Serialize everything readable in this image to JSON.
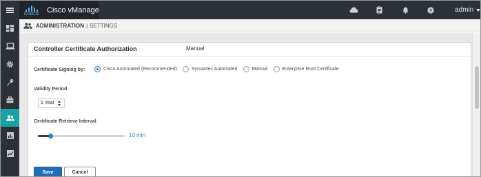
{
  "app": {
    "logo_text": "CISCO",
    "title": "Cisco vManage"
  },
  "header": {
    "icons": [
      "cloud-icon",
      "clipboard-icon",
      "bell-icon",
      "help-icon"
    ],
    "user": "admin"
  },
  "sidebar": {
    "items": [
      {
        "icon": "dashboard-icon",
        "active": false
      },
      {
        "icon": "monitor-icon",
        "active": false
      },
      {
        "icon": "configuration-gear-icon",
        "active": false
      },
      {
        "icon": "tools-wrench-icon",
        "active": false
      },
      {
        "icon": "maintenance-toolbox-icon",
        "active": false
      },
      {
        "icon": "administration-users-icon",
        "active": true
      },
      {
        "icon": "analytics-chart-icon",
        "active": false
      },
      {
        "icon": "reports-chart-icon",
        "active": false
      }
    ]
  },
  "breadcrumb": {
    "section": "ADMINISTRATION",
    "separator": "|",
    "page": "SETTINGS"
  },
  "panel": {
    "title": "Controller Certificate Authorization",
    "mode": "Manual",
    "signing": {
      "label": "Certificate Signing by:",
      "options": [
        {
          "label": "Cisco Automated (Recommended)",
          "selected": true
        },
        {
          "label": "Symantec Automated",
          "selected": false
        },
        {
          "label": "Manual",
          "selected": false
        },
        {
          "label": "Enterprise Root Certificate",
          "selected": false
        }
      ]
    },
    "validity": {
      "label": "Validity Period",
      "value": "1 Year"
    },
    "retrieve": {
      "label": "Certificate Retrieve Interval",
      "value_text": "10 min",
      "slider_fraction": 0.14
    },
    "buttons": {
      "save": "Save",
      "cancel": "Cancel"
    }
  },
  "colors": {
    "header_bg": "#2b3137",
    "active_nav": "#17a2a6",
    "primary": "#1f6fb2",
    "slider_thumb": "#1b8fd6"
  }
}
